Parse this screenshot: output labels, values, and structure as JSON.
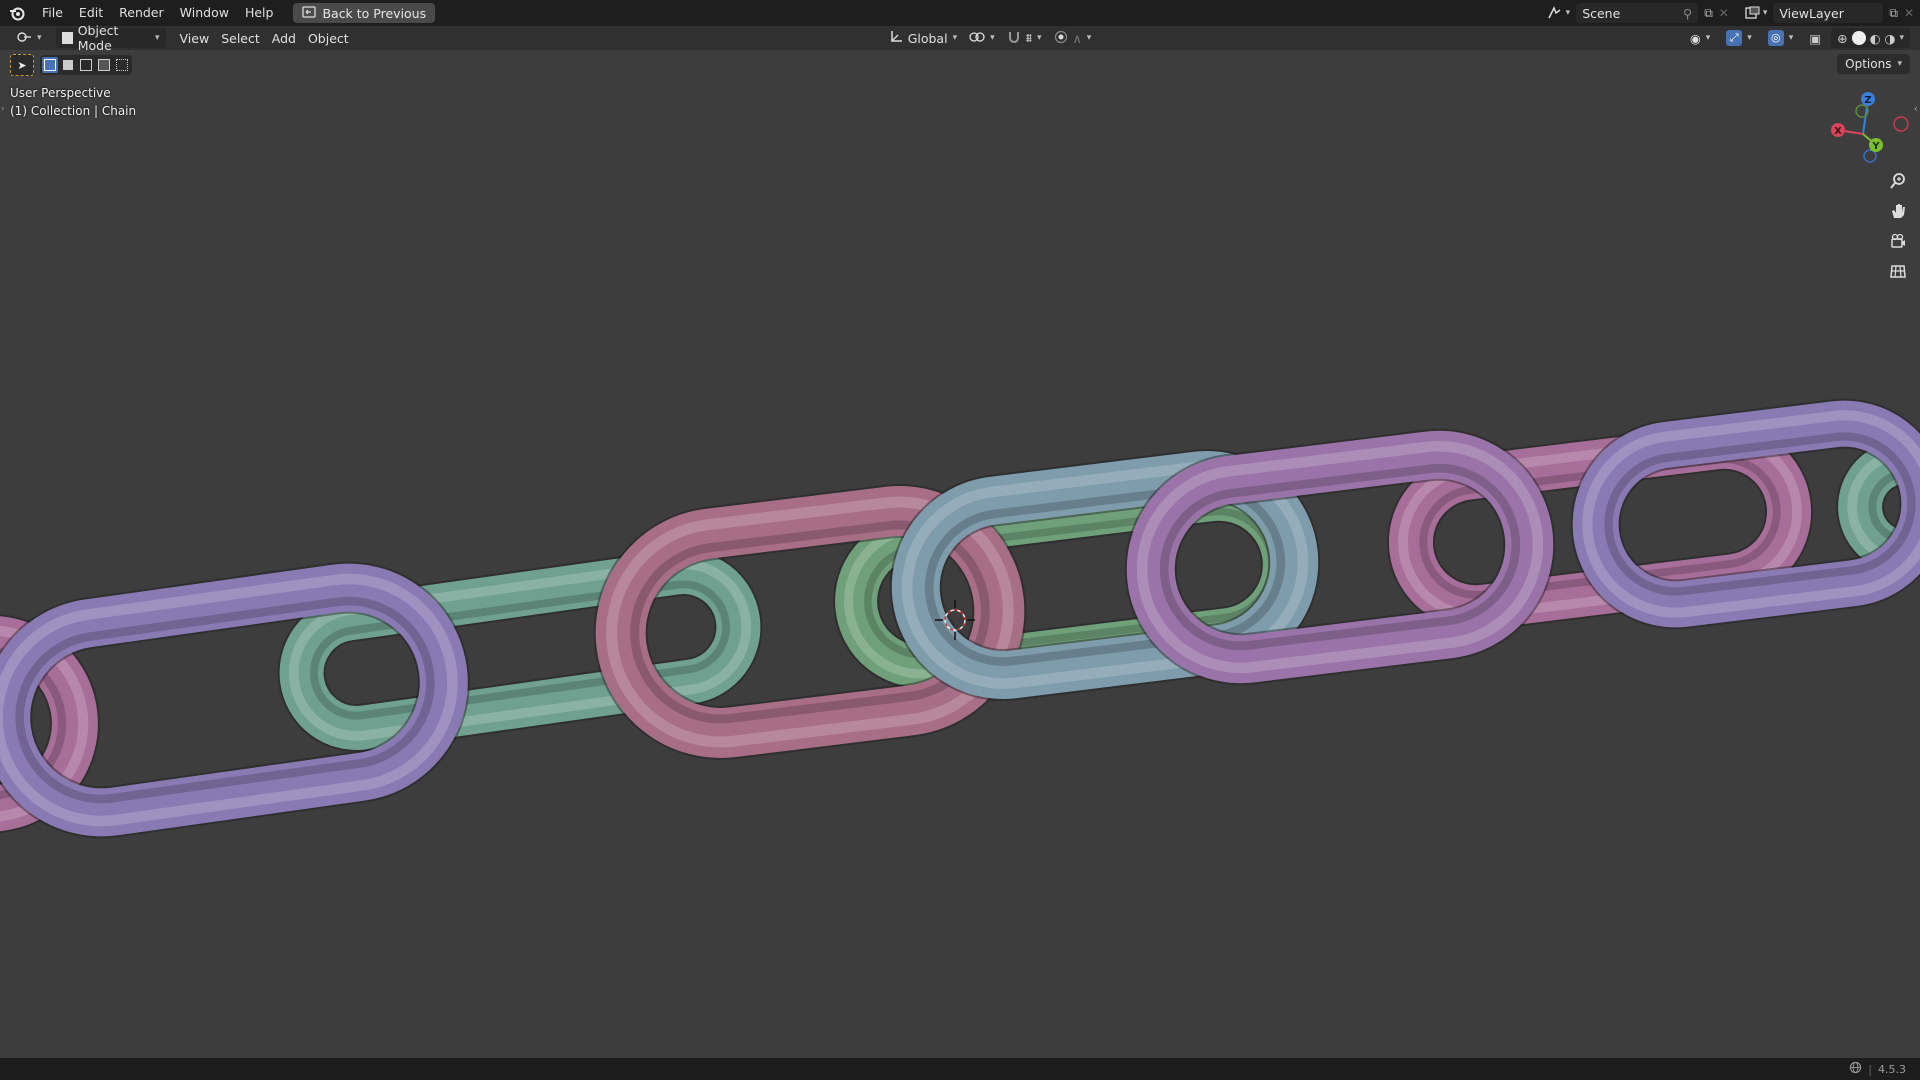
{
  "topbar": {
    "menus": [
      "File",
      "Edit",
      "Render",
      "Window",
      "Help"
    ],
    "back_label": "Back to Previous",
    "scene_label": "Scene",
    "viewlayer_label": "ViewLayer"
  },
  "header": {
    "mode_label": "Object Mode",
    "menus": [
      "View",
      "Select",
      "Add",
      "Object"
    ],
    "orientation_label": "Global"
  },
  "viewport": {
    "perspective_label": "User Perspective",
    "collection_label": "(1) Collection | Chain",
    "options_label": "Options",
    "gizmo": {
      "z": "Z",
      "x": "X",
      "y": "Y"
    },
    "link_colors": [
      "#a86e9a",
      "#8a7ab4",
      "#6fa090",
      "#a86e86",
      "#6fa07a",
      "#7e9cac",
      "#9a74a8"
    ]
  },
  "status": {
    "version": "4.5.3"
  },
  "icons": [
    "blender-logo-icon",
    "back-icon",
    "scene-icon",
    "pin-icon",
    "viewlayer-icon",
    "editor-type-icon",
    "mode-icon",
    "transform-icon",
    "pivot-icon",
    "snap-icon",
    "proportional-icon",
    "zoom-icon",
    "hand-icon",
    "camera-icon",
    "grid-icon",
    "globe-icon"
  ]
}
